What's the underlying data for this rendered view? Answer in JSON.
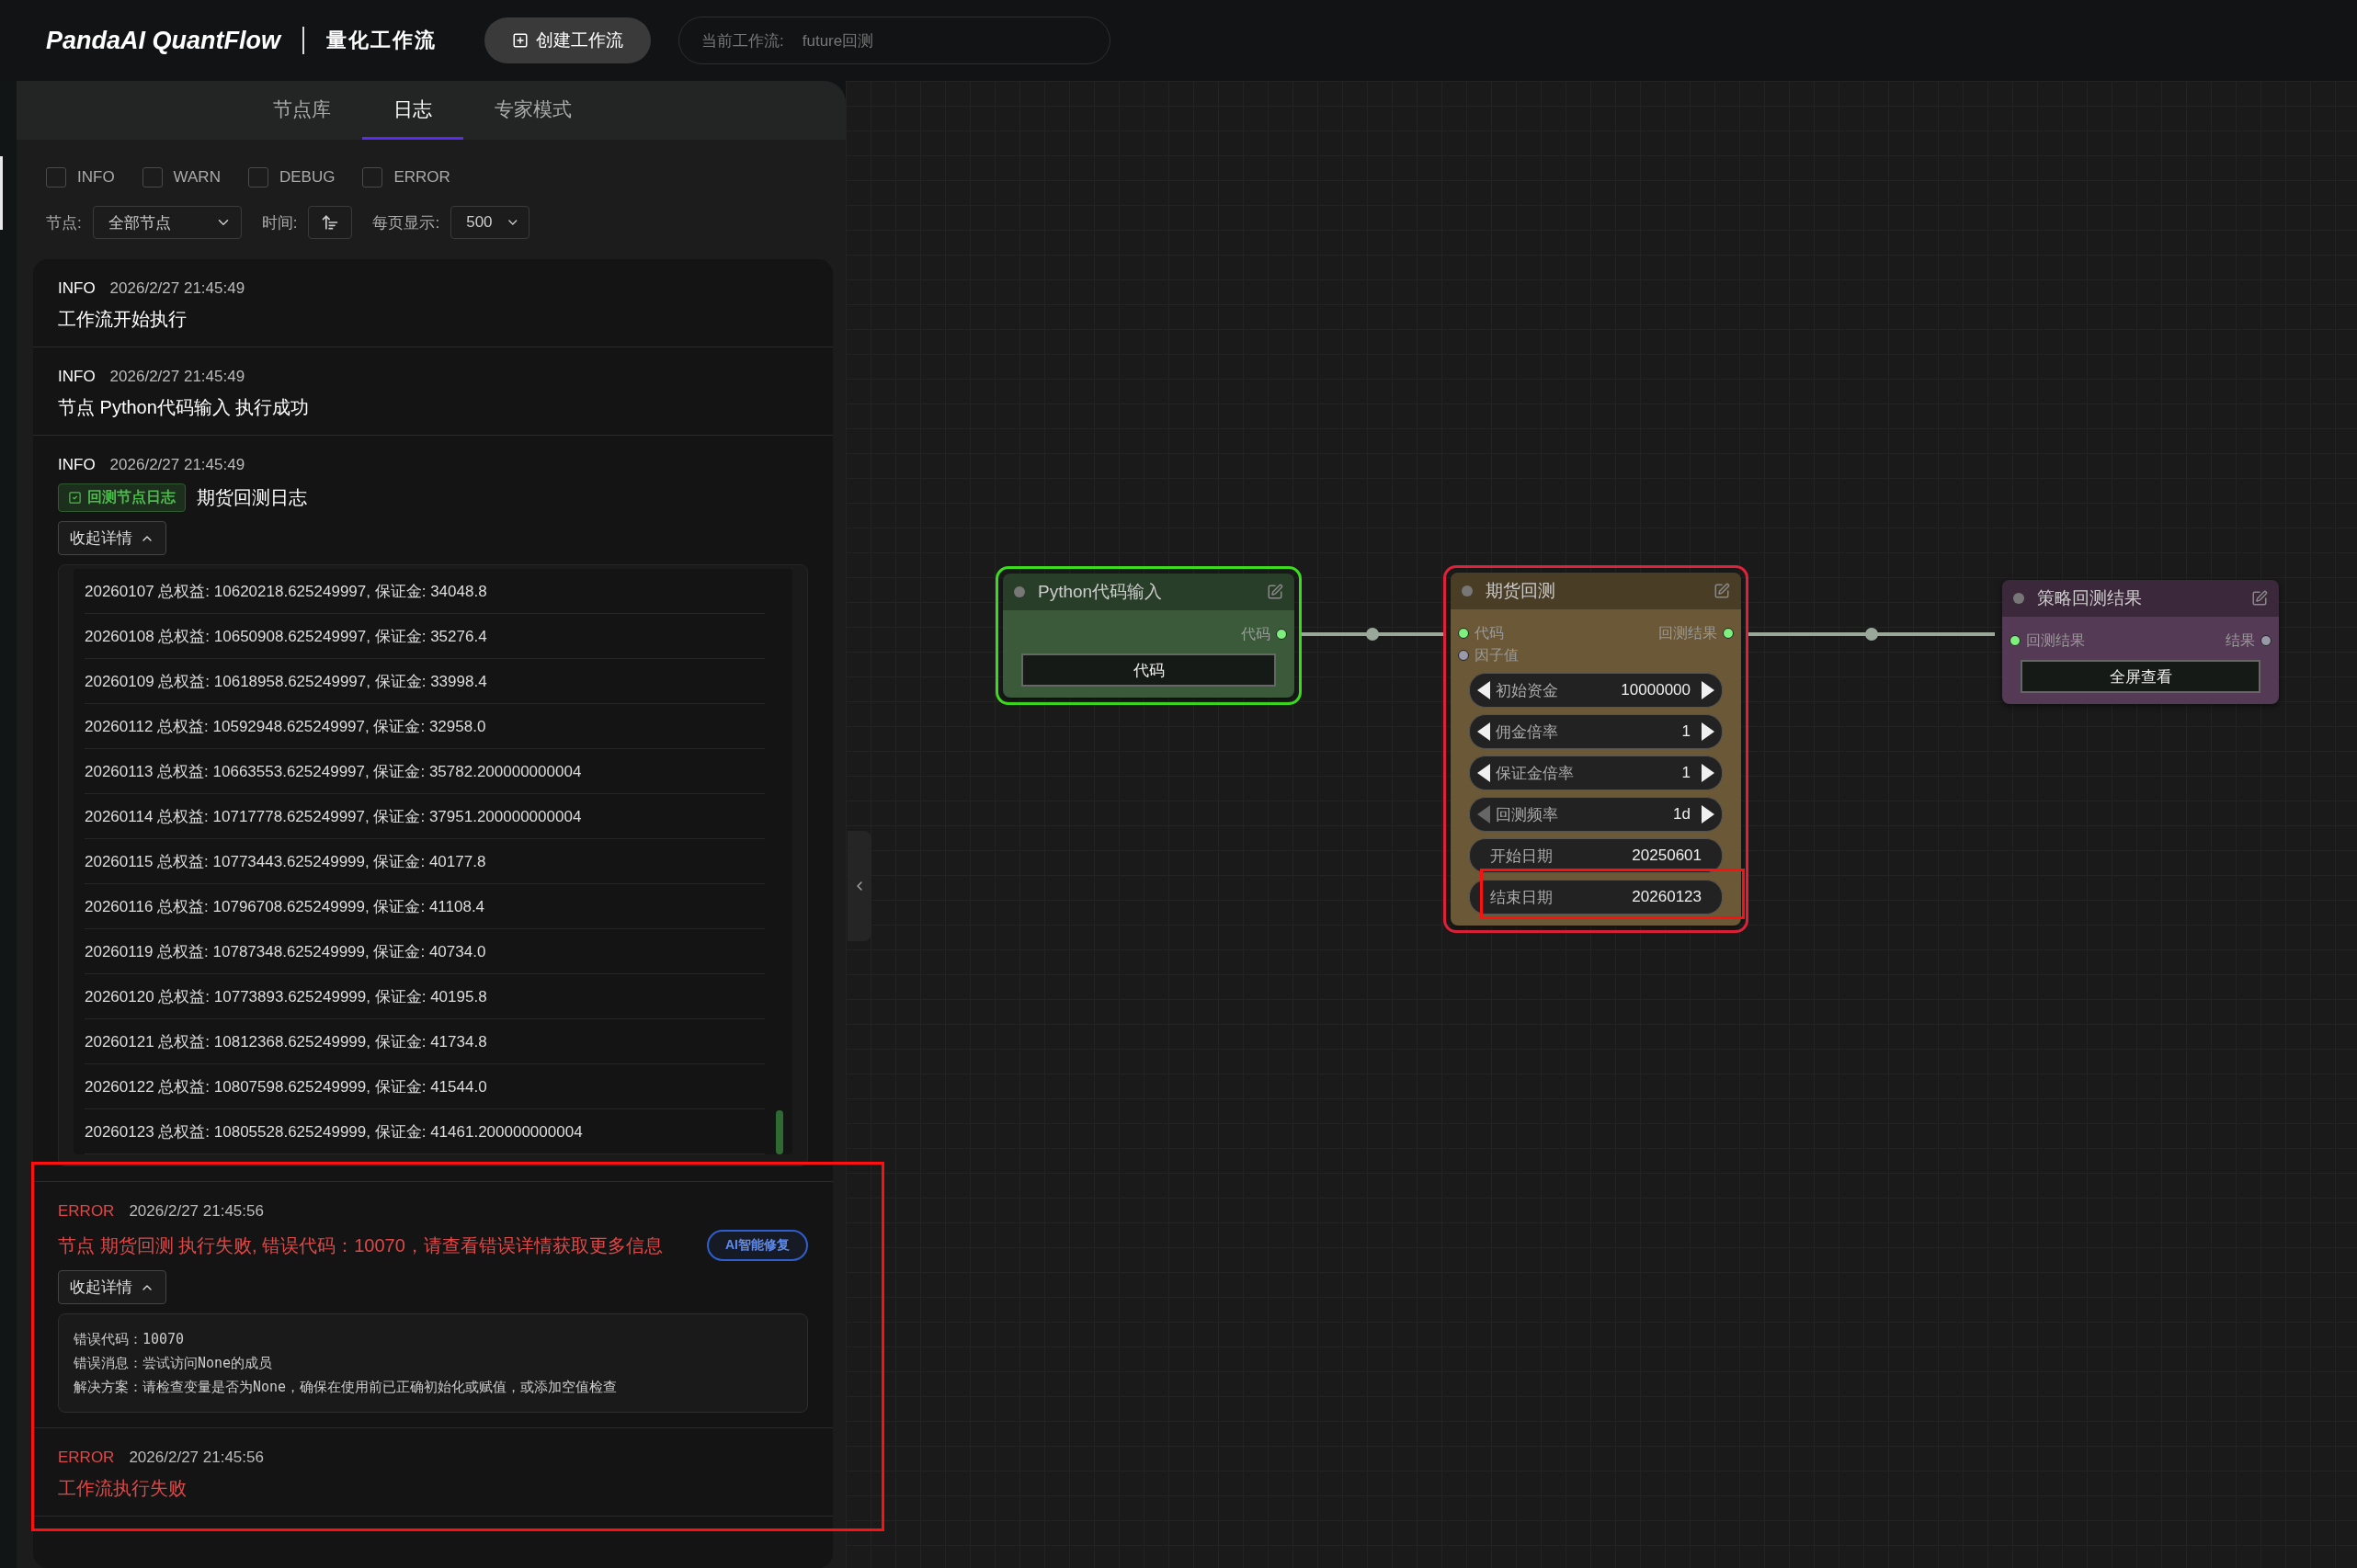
{
  "header": {
    "logo": "PandaAI QuantFlow",
    "subtitle": "量化工作流",
    "create_button": "创建工作流",
    "workflow_label": "当前工作流:",
    "workflow_name": "future回测"
  },
  "panel": {
    "tabs": [
      {
        "label": "节点库",
        "selected": false
      },
      {
        "label": "日志",
        "selected": true
      },
      {
        "label": "专家模式",
        "selected": false
      }
    ],
    "level_filters": [
      {
        "label": "INFO",
        "checked": false
      },
      {
        "label": "WARN",
        "checked": false
      },
      {
        "label": "DEBUG",
        "checked": false
      },
      {
        "label": "ERROR",
        "checked": false
      }
    ],
    "node_filter": {
      "label": "节点:",
      "value": "全部节点"
    },
    "time_sort": {
      "label": "时间:"
    },
    "page_size": {
      "label": "每页显示:",
      "value": "500"
    },
    "logs": [
      {
        "level": "INFO",
        "time": "2026/2/27 21:45:49",
        "message": "工作流开始执行",
        "highlighted": false
      },
      {
        "level": "INFO",
        "time": "2026/2/27 21:45:49",
        "message": "节点 Python代码输入 执行成功",
        "highlighted": false
      },
      {
        "level": "INFO",
        "time": "2026/2/27 21:45:49",
        "badge": "回测节点日志",
        "message": "期货回测日志",
        "toggle": "收起详情",
        "expanded": true,
        "highlighted": false,
        "details": [
          "20260107 总权益: 10620218.625249997, 保证金: 34048.8",
          "20260108 总权益: 10650908.625249997, 保证金: 35276.4",
          "20260109 总权益: 10618958.625249997, 保证金: 33998.4",
          "20260112 总权益: 10592948.625249997, 保证金: 32958.0",
          "20260113 总权益: 10663553.625249997, 保证金: 35782.200000000004",
          "20260114 总权益: 10717778.625249997, 保证金: 37951.200000000004",
          "20260115 总权益: 10773443.625249999, 保证金: 40177.8",
          "20260116 总权益: 10796708.625249999, 保证金: 41108.4",
          "20260119 总权益: 10787348.625249999, 保证金: 40734.0",
          "20260120 总权益: 10773893.625249999, 保证金: 40195.8",
          "20260121 总权益: 10812368.625249999, 保证金: 41734.8",
          "20260122 总权益: 10807598.625249999, 保证金: 41544.0",
          "20260123 总权益: 10805528.625249999, 保证金: 41461.200000000004"
        ]
      },
      {
        "level": "ERROR",
        "time": "2026/2/27 21:45:56",
        "message": "节点 期货回测 执行失败, 错误代码：10070，请查看错误详情获取更多信息",
        "action": "AI智能修复",
        "toggle": "收起详情",
        "expanded": true,
        "highlighted": true,
        "error_details": [
          "错误代码：10070",
          "错误消息：尝试访问None的成员",
          "解决方案：请检查变量是否为None，确保在使用前已正确初始化或赋值，或添加空值检查"
        ]
      },
      {
        "level": "ERROR",
        "time": "2026/2/27 21:45:56",
        "message": "工作流执行失败",
        "highlighted": true
      }
    ]
  },
  "canvas": {
    "nodes": [
      {
        "title": "Python代码输入",
        "color": "#3a5a3a",
        "succeeded": true,
        "failed": false,
        "outputs": [
          {
            "label": "代码",
            "connected": true
          }
        ],
        "widgets": [
          {
            "kind": "button",
            "label": "代码"
          }
        ]
      },
      {
        "title": "期货回测",
        "color": "#6b5836",
        "succeeded": false,
        "failed": true,
        "inputs": [
          {
            "label": "代码",
            "connected": true
          },
          {
            "label": "因子值",
            "connected": false
          }
        ],
        "outputs": [
          {
            "label": "回测结果",
            "connected": true
          }
        ],
        "widgets": [
          {
            "kind": "number",
            "label": "初始资金",
            "value": "10000000",
            "prev_disabled": false,
            "highlighted": false
          },
          {
            "kind": "number",
            "label": "佣金倍率",
            "value": "1",
            "prev_disabled": false,
            "highlighted": false
          },
          {
            "kind": "number",
            "label": "保证金倍率",
            "value": "1",
            "prev_disabled": false,
            "highlighted": false
          },
          {
            "kind": "number",
            "label": "回测频率",
            "value": "1d",
            "prev_disabled": true,
            "highlighted": false
          },
          {
            "kind": "text",
            "label": "开始日期",
            "value": "20250601",
            "highlighted": false
          },
          {
            "kind": "text",
            "label": "结束日期",
            "value": "20260123",
            "highlighted": true
          }
        ]
      },
      {
        "title": "策略回测结果",
        "color": "#553a55",
        "succeeded": false,
        "failed": false,
        "inputs": [
          {
            "label": "回测结果",
            "connected": true
          }
        ],
        "outputs": [
          {
            "label": "结果",
            "connected": false
          }
        ],
        "widgets": [
          {
            "kind": "button",
            "label": "全屏查看"
          }
        ]
      }
    ]
  }
}
